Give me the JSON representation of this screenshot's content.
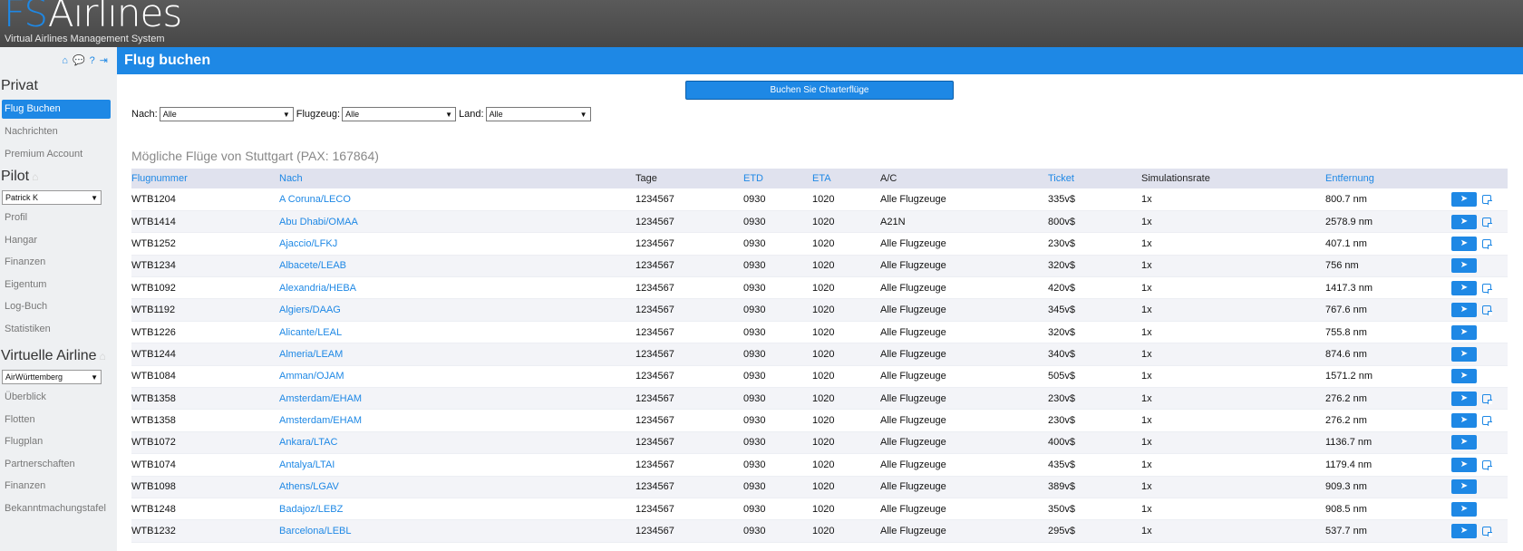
{
  "header": {
    "logo_fs": "FS",
    "logo_rest": "Airlines",
    "tagline": "Virtual Airlines Management System"
  },
  "sidebar": {
    "icons": [
      "home-icon",
      "chat-icon",
      "help-icon",
      "logout-icon"
    ],
    "private_heading": "Privat",
    "private_items": [
      "Flug Buchen",
      "Nachrichten",
      "Premium Account"
    ],
    "pilot_heading": "Pilot",
    "pilot_select": "Patrick K",
    "pilot_items": [
      "Profil",
      "Hangar",
      "Finanzen",
      "Eigentum",
      "Log-Buch",
      "Statistiken"
    ],
    "airline_heading": "Virtuelle Airline",
    "airline_select": "AirWürttemberg",
    "airline_items": [
      "Überblick",
      "Flotten",
      "Flugplan",
      "Partnerschaften",
      "Finanzen",
      "Bekanntmachungstafel"
    ]
  },
  "page": {
    "title": "Flug buchen",
    "charter_button": "Buchen Sie Charterflüge",
    "filters": {
      "nach_label": "Nach:",
      "nach_value": "Alle",
      "flugzeug_label": "Flugzeug:",
      "flugzeug_value": "Alle",
      "land_label": "Land:",
      "land_value": "Alle"
    },
    "section_title": "Mögliche Flüge von Stuttgart (PAX: 167864)"
  },
  "table": {
    "columns": [
      "Flugnummer",
      "Nach",
      "Tage",
      "ETD",
      "ETA",
      "A/C",
      "Ticket",
      "Simulationsrate",
      "Entfernung"
    ],
    "rows": [
      {
        "flight": "WTB1204",
        "dest": "A Coruna/LECO",
        "days": "1234567",
        "etd": "0930",
        "eta": "1020",
        "ac": "Alle Flugzeuge",
        "ticket": "335v$",
        "rate": "1x",
        "dist": "800.7 nm",
        "note": true
      },
      {
        "flight": "WTB1414",
        "dest": "Abu Dhabi/OMAA",
        "days": "1234567",
        "etd": "0930",
        "eta": "1020",
        "ac": "A21N",
        "ticket": "800v$",
        "rate": "1x",
        "dist": "2578.9 nm",
        "note": true
      },
      {
        "flight": "WTB1252",
        "dest": "Ajaccio/LFKJ",
        "days": "1234567",
        "etd": "0930",
        "eta": "1020",
        "ac": "Alle Flugzeuge",
        "ticket": "230v$",
        "rate": "1x",
        "dist": "407.1 nm",
        "note": true
      },
      {
        "flight": "WTB1234",
        "dest": "Albacete/LEAB",
        "days": "1234567",
        "etd": "0930",
        "eta": "1020",
        "ac": "Alle Flugzeuge",
        "ticket": "320v$",
        "rate": "1x",
        "dist": "756 nm",
        "note": false
      },
      {
        "flight": "WTB1092",
        "dest": "Alexandria/HEBA",
        "days": "1234567",
        "etd": "0930",
        "eta": "1020",
        "ac": "Alle Flugzeuge",
        "ticket": "420v$",
        "rate": "1x",
        "dist": "1417.3 nm",
        "note": true
      },
      {
        "flight": "WTB1192",
        "dest": "Algiers/DAAG",
        "days": "1234567",
        "etd": "0930",
        "eta": "1020",
        "ac": "Alle Flugzeuge",
        "ticket": "345v$",
        "rate": "1x",
        "dist": "767.6 nm",
        "note": true
      },
      {
        "flight": "WTB1226",
        "dest": "Alicante/LEAL",
        "days": "1234567",
        "etd": "0930",
        "eta": "1020",
        "ac": "Alle Flugzeuge",
        "ticket": "320v$",
        "rate": "1x",
        "dist": "755.8 nm",
        "note": false
      },
      {
        "flight": "WTB1244",
        "dest": "Almeria/LEAM",
        "days": "1234567",
        "etd": "0930",
        "eta": "1020",
        "ac": "Alle Flugzeuge",
        "ticket": "340v$",
        "rate": "1x",
        "dist": "874.6 nm",
        "note": false
      },
      {
        "flight": "WTB1084",
        "dest": "Amman/OJAM",
        "days": "1234567",
        "etd": "0930",
        "eta": "1020",
        "ac": "Alle Flugzeuge",
        "ticket": "505v$",
        "rate": "1x",
        "dist": "1571.2 nm",
        "note": false
      },
      {
        "flight": "WTB1358",
        "dest": "Amsterdam/EHAM",
        "days": "1234567",
        "etd": "0930",
        "eta": "1020",
        "ac": "Alle Flugzeuge",
        "ticket": "230v$",
        "rate": "1x",
        "dist": "276.2 nm",
        "note": true
      },
      {
        "flight": "WTB1358",
        "dest": "Amsterdam/EHAM",
        "days": "1234567",
        "etd": "0930",
        "eta": "1020",
        "ac": "Alle Flugzeuge",
        "ticket": "230v$",
        "rate": "1x",
        "dist": "276.2 nm",
        "note": true
      },
      {
        "flight": "WTB1072",
        "dest": "Ankara/LTAC",
        "days": "1234567",
        "etd": "0930",
        "eta": "1020",
        "ac": "Alle Flugzeuge",
        "ticket": "400v$",
        "rate": "1x",
        "dist": "1136.7 nm",
        "note": false
      },
      {
        "flight": "WTB1074",
        "dest": "Antalya/LTAI",
        "days": "1234567",
        "etd": "0930",
        "eta": "1020",
        "ac": "Alle Flugzeuge",
        "ticket": "435v$",
        "rate": "1x",
        "dist": "1179.4 nm",
        "note": true
      },
      {
        "flight": "WTB1098",
        "dest": "Athens/LGAV",
        "days": "1234567",
        "etd": "0930",
        "eta": "1020",
        "ac": "Alle Flugzeuge",
        "ticket": "389v$",
        "rate": "1x",
        "dist": "909.3 nm",
        "note": false
      },
      {
        "flight": "WTB1248",
        "dest": "Badajoz/LEBZ",
        "days": "1234567",
        "etd": "0930",
        "eta": "1020",
        "ac": "Alle Flugzeuge",
        "ticket": "350v$",
        "rate": "1x",
        "dist": "908.5 nm",
        "note": false
      },
      {
        "flight": "WTB1232",
        "dest": "Barcelona/LEBL",
        "days": "1234567",
        "etd": "0930",
        "eta": "1020",
        "ac": "Alle Flugzeuge",
        "ticket": "295v$",
        "rate": "1x",
        "dist": "537.7 nm",
        "note": true
      }
    ]
  },
  "colors": {
    "accent": "#1e88e5",
    "header_bg": "#4f4f4f",
    "sidebar_bg": "#eef0f2",
    "table_header_bg": "#e0e2ee"
  }
}
